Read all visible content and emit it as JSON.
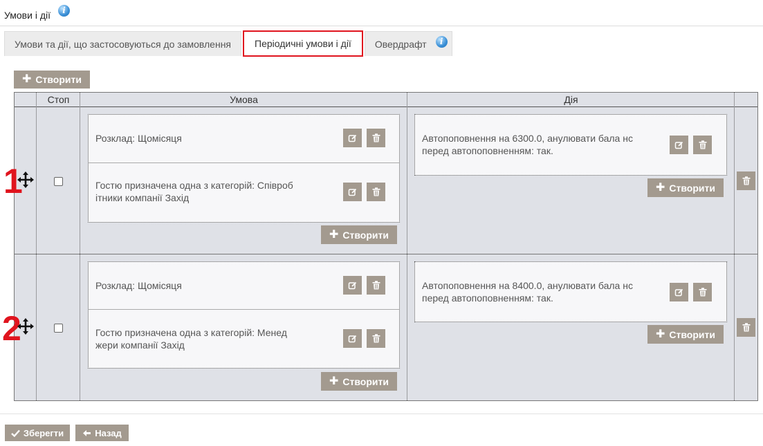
{
  "header": {
    "title": "Умови і дії",
    "info_icon": "info-icon"
  },
  "tabs": [
    {
      "label": "Умови та дії, що застосовуються до замовлення"
    },
    {
      "label": "Періодичні умови і дії",
      "active": true
    },
    {
      "label": "Овердрафт"
    }
  ],
  "toolbar": {
    "create_label": "Створити"
  },
  "table": {
    "col_stop": "Стоп",
    "col_condition": "Умова",
    "col_action": "Дія",
    "rows": [
      {
        "number": "1",
        "stop_checked": false,
        "conditions": [
          "Розклад: Щомісяця",
          "Гостю призначена одна з категорій: Співроб ітники компанії Захід"
        ],
        "actions": [
          "Автопоповнення на 6300.0, анулювати бала нс перед автопоповненням: так."
        ],
        "create_condition_label": "Створити",
        "create_action_label": "Створити"
      },
      {
        "number": "2",
        "stop_checked": false,
        "conditions": [
          "Розклад: Щомісяця",
          "Гостю призначена одна з категорій: Менед жери компанії Захід"
        ],
        "actions": [
          "Автопоповнення на 8400.0, анулювати бала нс перед автопоповненням: так."
        ],
        "create_condition_label": "Створити",
        "create_action_label": "Створити"
      }
    ]
  },
  "footer": {
    "save_label": "Зберегти",
    "back_label": "Назад"
  },
  "colors": {
    "button": "#a39a8f",
    "grid_bg": "#dfe1e7",
    "card_bg": "#f7f7f9",
    "highlight": "#e0141e"
  }
}
